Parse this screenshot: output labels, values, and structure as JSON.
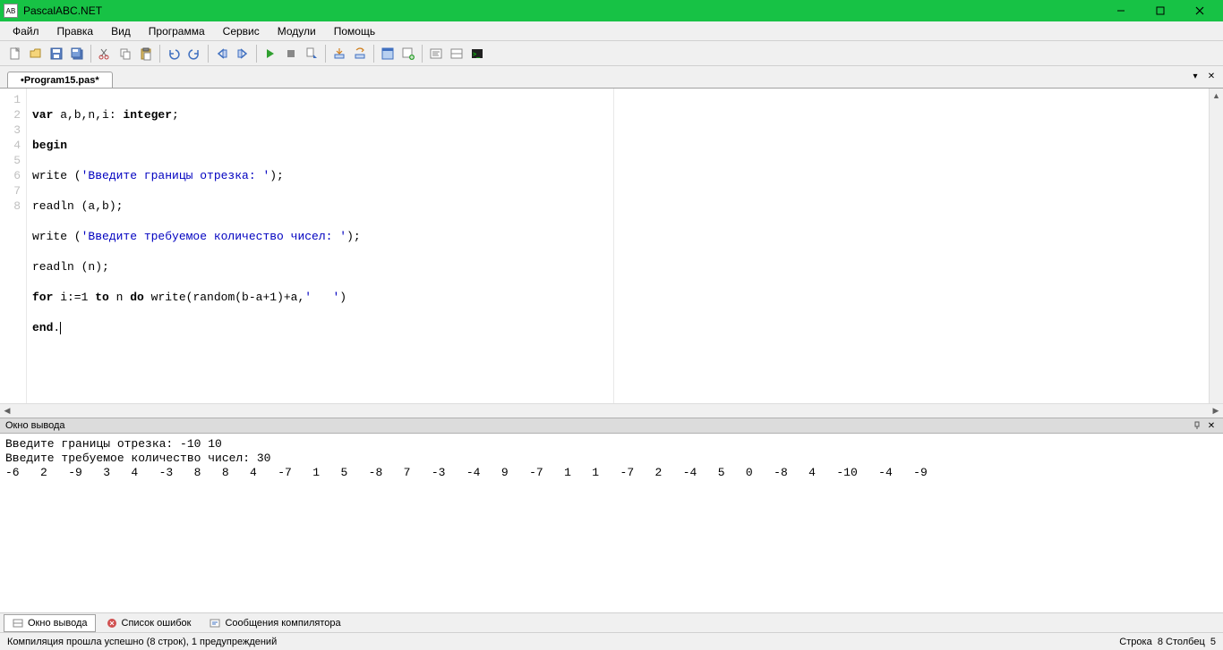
{
  "titlebar": {
    "app_title": "PascalABC.NET"
  },
  "menus": [
    "Файл",
    "Правка",
    "Вид",
    "Программа",
    "Сервис",
    "Модули",
    "Помощь"
  ],
  "tabs": {
    "active": "•Program15.pas*"
  },
  "editor": {
    "line_numbers": [
      1,
      2,
      3,
      4,
      5,
      6,
      7,
      8
    ],
    "lines": [
      {
        "kw1": "var",
        "t1": " a,b,n,i: ",
        "kw2": "integer",
        "t2": ";"
      },
      {
        "kw1": "begin",
        "t1": ""
      },
      {
        "t0": "write (",
        "str": "'Введите границы отрезка: '",
        "t1": ");"
      },
      {
        "t0": "readln (a,b);"
      },
      {
        "t0": "write (",
        "str": "'Введите требуемое количество чисел: '",
        "t1": ");"
      },
      {
        "t0": "readln (n);"
      },
      {
        "kw1": "for",
        "t1": " i:=1 ",
        "kw2": "to",
        "t2": " n ",
        "kw3": "do",
        "t3": " write(random(b-a+1)+a,",
        "str": "'   '",
        "t4": ")"
      },
      {
        "kw1": "end",
        "t1": "."
      }
    ]
  },
  "output": {
    "title": "Окно вывода",
    "lines": [
      "Введите границы отрезка: -10 10",
      "Введите требуемое количество чисел: 30",
      "-6   2   -9   3   4   -3   8   8   4   -7   1   5   -8   7   -3   -4   9   -7   1   1   -7   2   -4   5   0   -8   4   -10   -4   -9   "
    ]
  },
  "bottom_tabs": {
    "output": "Окно вывода",
    "errors": "Список ошибок",
    "compiler": "Сообщения компилятора"
  },
  "status": {
    "left": "Компиляция прошла успешно (8 строк), 1 предупреждений",
    "right_line_label": "Строка",
    "right_line": "8",
    "right_col_label": "Столбец",
    "right_col": "5"
  }
}
